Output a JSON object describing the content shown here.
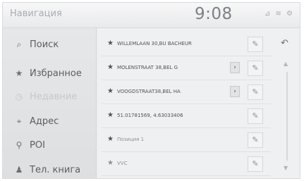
{
  "header": {
    "title": "Навигация",
    "clock": "9:08",
    "status": "⊿ ≋ ⚙"
  },
  "sidebar": {
    "items": [
      {
        "label": "Поиск",
        "icon": "search-icon",
        "glyph": "⌕"
      },
      {
        "label": "Избранное",
        "icon": "star-icon",
        "glyph": "★"
      },
      {
        "label": "Недавние",
        "icon": "clock-icon",
        "glyph": "◷",
        "faded": true
      },
      {
        "label": "Адрес",
        "icon": "address-icon",
        "glyph": "⌖"
      },
      {
        "label": "POI",
        "icon": "pin-icon",
        "glyph": "⚲"
      },
      {
        "label": "Тел. книга",
        "icon": "contact-icon",
        "glyph": "♟"
      }
    ]
  },
  "favorites": [
    {
      "star": "★",
      "text": "WILLEMLAAN 30,BU BACHEUR",
      "expand": false
    },
    {
      "star": "★",
      "text": "MOLENSTRAAT 38,BEL G",
      "expand": true
    },
    {
      "star": "★",
      "text": "VOOGDSTRAAT38,BEL HA",
      "expand": true
    },
    {
      "star": "★",
      "text": "51.01781569, 4.63033406",
      "expand": false
    },
    {
      "star": "★",
      "text": "Позиция 1",
      "expand": false,
      "gray": true
    },
    {
      "star": "★",
      "text": "VVC",
      "expand": false,
      "gray": true
    }
  ],
  "controls": {
    "expand_glyph": "›",
    "edit_glyph": "✎",
    "back_glyph": "↶",
    "scroll_up_glyph": "▲",
    "scroll_down_glyph": "▼"
  }
}
